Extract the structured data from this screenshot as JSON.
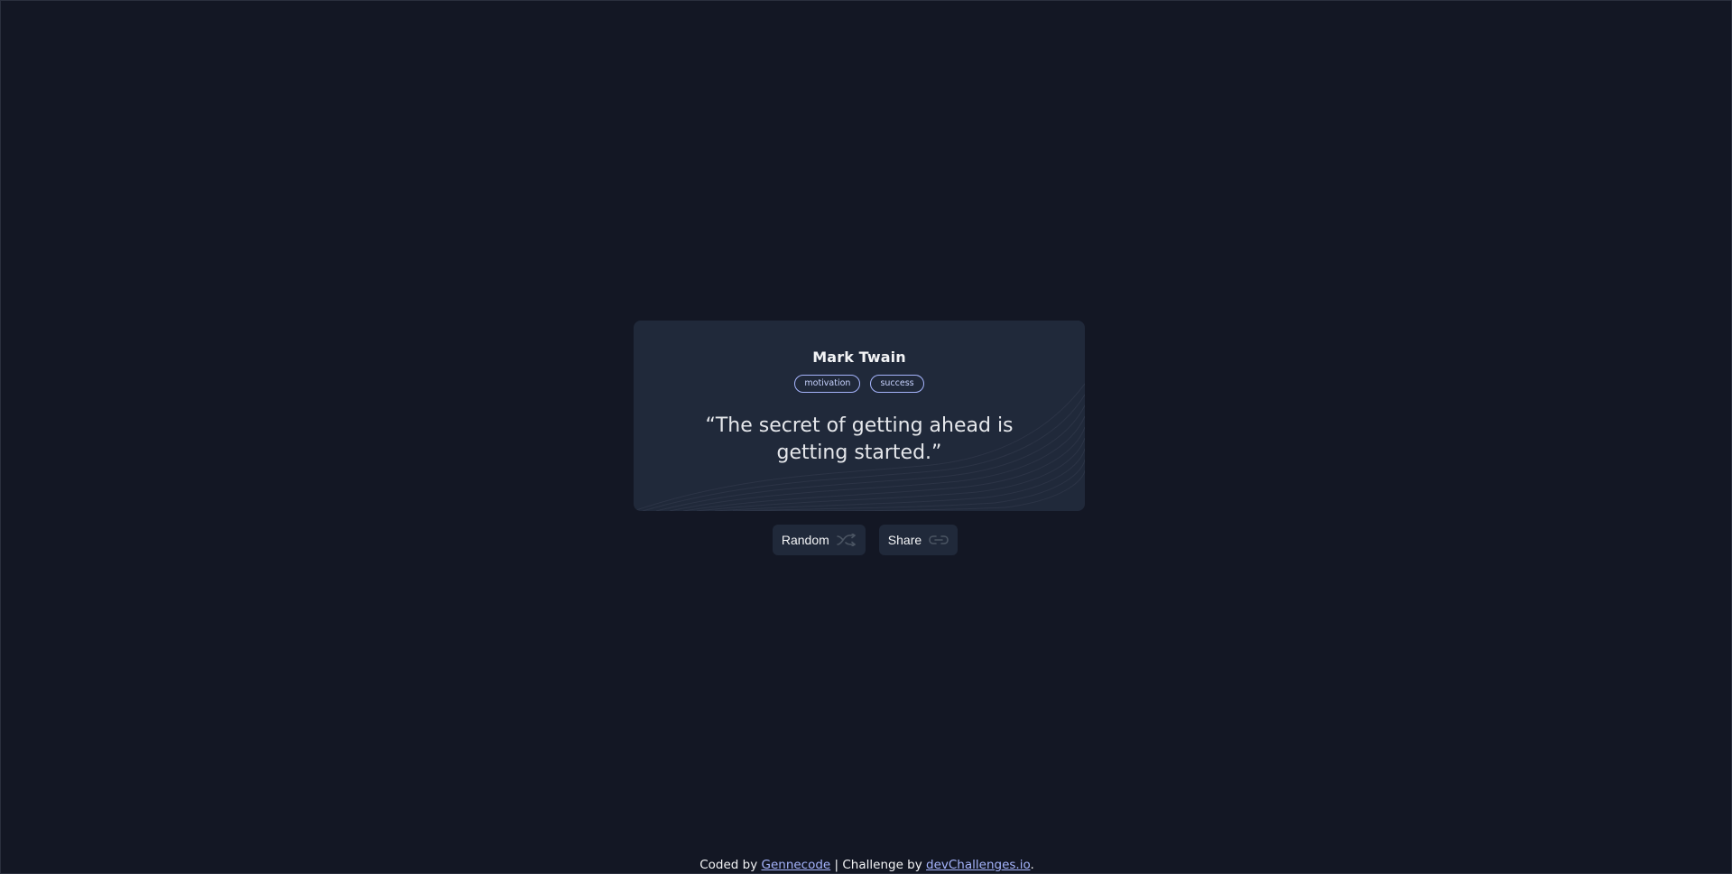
{
  "quote": {
    "author": "Mark Twain",
    "tags": [
      "motivation",
      "success"
    ],
    "text": "“The secret of getting ahead is getting started.”"
  },
  "actions": {
    "random_label": "Random",
    "share_label": "Share"
  },
  "footer": {
    "prefix": "Coded by ",
    "author_link": "Gennecode",
    "middle": " | Challenge by ",
    "challenge_link": "devChallenges.io",
    "suffix": "."
  },
  "colors": {
    "background": "#131724",
    "card": "#20293a",
    "accent": "#a5b4fc"
  },
  "icons": {
    "random": "shuffle-icon",
    "share": "link-icon"
  }
}
